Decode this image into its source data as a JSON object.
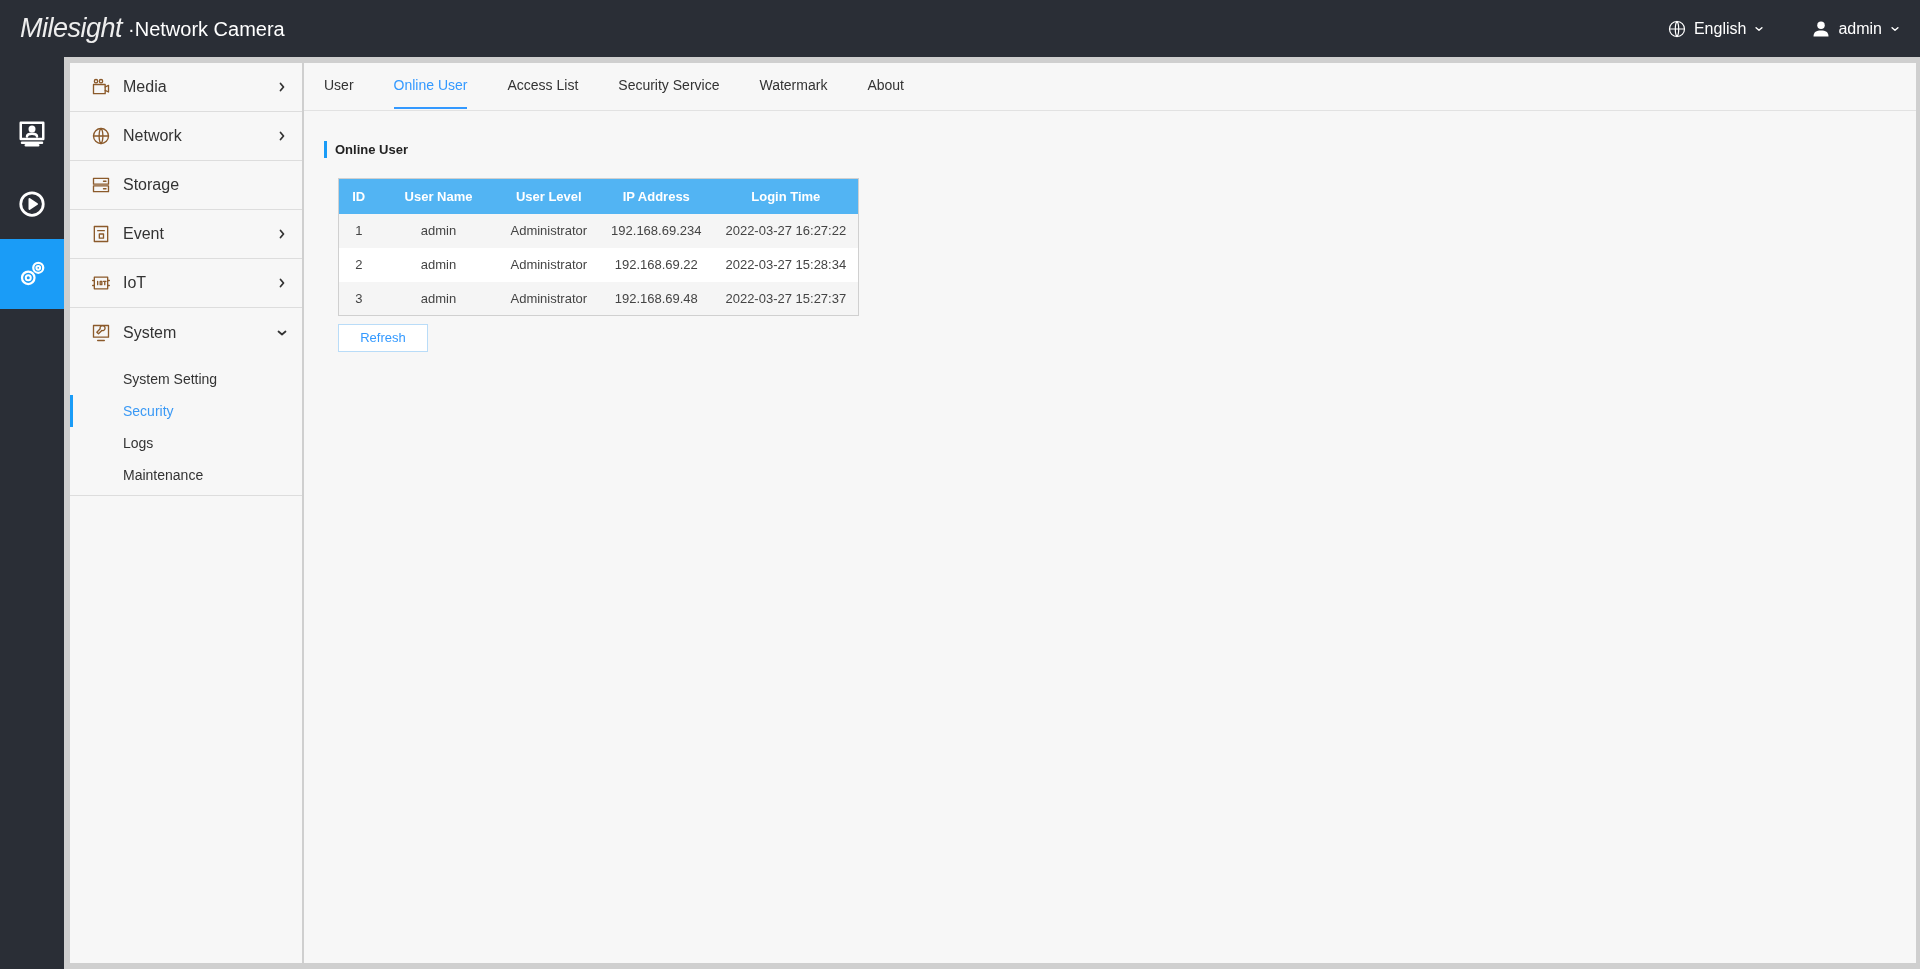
{
  "header": {
    "logo": "Milesight",
    "product": "·Network Camera",
    "language": "English",
    "user": "admin"
  },
  "rail": [
    {
      "kind": "live",
      "selected": false
    },
    {
      "kind": "playback",
      "selected": false
    },
    {
      "kind": "settings",
      "selected": true
    }
  ],
  "menu": [
    {
      "kind": "media",
      "label": "Media",
      "expanded": false
    },
    {
      "kind": "network",
      "label": "Network",
      "expanded": false
    },
    {
      "kind": "storage",
      "label": "Storage"
    },
    {
      "kind": "event",
      "label": "Event",
      "expanded": false
    },
    {
      "kind": "iot",
      "label": "IoT",
      "expanded": false
    },
    {
      "kind": "system",
      "label": "System",
      "expanded": true,
      "children": [
        {
          "label": "System Setting",
          "selected": false
        },
        {
          "label": "Security",
          "selected": true
        },
        {
          "label": "Logs",
          "selected": false
        },
        {
          "label": "Maintenance",
          "selected": false
        }
      ]
    }
  ],
  "tabs": [
    {
      "label": "User",
      "selected": false
    },
    {
      "label": "Online User",
      "selected": true
    },
    {
      "label": "Access List",
      "selected": false
    },
    {
      "label": "Security Service",
      "selected": false
    },
    {
      "label": "Watermark",
      "selected": false
    },
    {
      "label": "About",
      "selected": false
    }
  ],
  "section_title": "Online User",
  "table": {
    "columns": [
      "ID",
      "User Name",
      "User Level",
      "IP Address",
      "Login Time"
    ],
    "rows": [
      [
        "1",
        "admin",
        "Administrator",
        "192.168.69.234",
        "2022-03-27 16:27:22"
      ],
      [
        "2",
        "admin",
        "Administrator",
        "192.168.69.22",
        "2022-03-27 15:28:34"
      ],
      [
        "3",
        "admin",
        "Administrator",
        "192.168.69.48",
        "2022-03-27 15:27:37"
      ]
    ]
  },
  "refresh_button": "Refresh"
}
